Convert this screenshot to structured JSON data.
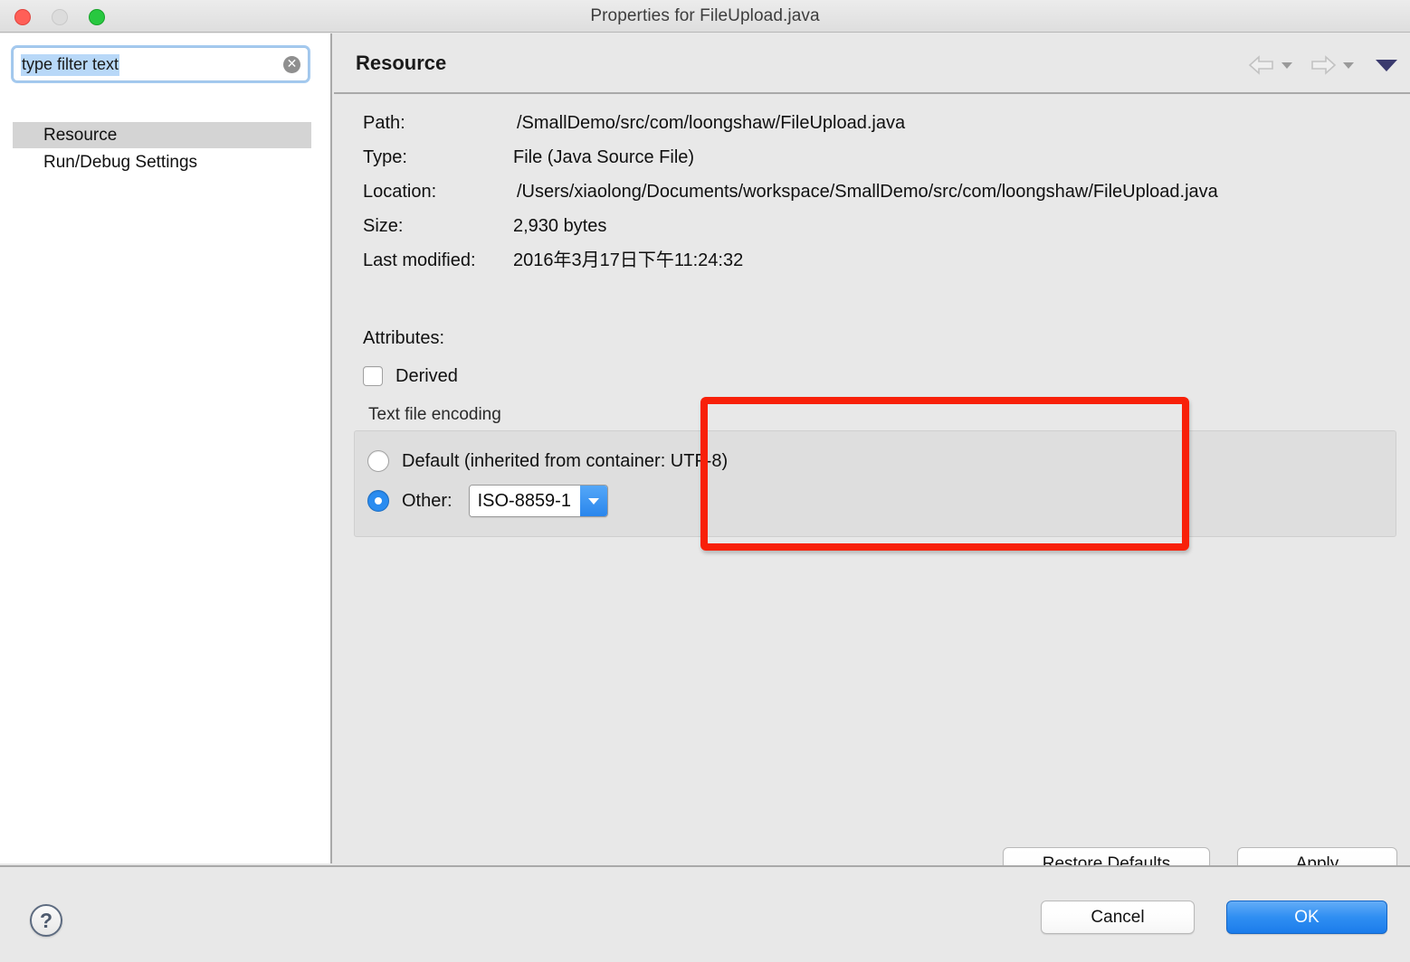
{
  "window": {
    "title": "Properties for FileUpload.java",
    "traffic_lights": {
      "close": "close-button",
      "minimize": "minimize-button",
      "zoom": "zoom-button"
    }
  },
  "sidebar": {
    "filter": {
      "value": "type filter text",
      "placeholder": "type filter text",
      "clear_icon": "clear-icon",
      "clear_glyph": "✕"
    },
    "items": [
      {
        "label": "Resource",
        "selected": true
      },
      {
        "label": "Run/Debug Settings",
        "selected": false
      }
    ]
  },
  "content": {
    "page_title": "Resource",
    "nav": {
      "back_icon": "arrow-left-icon",
      "forward_icon": "arrow-right-icon",
      "menu_icon": "chevron-down-icon"
    },
    "properties": [
      {
        "label": "Path:",
        "value": "/SmallDemo/src/com/loongshaw/FileUpload.java"
      },
      {
        "label": "Type:",
        "value": "File  (Java Source File)"
      },
      {
        "label": "Location:",
        "value": "/Users/xiaolong/Documents/workspace/SmallDemo/src/com/loongshaw/FileUpload.java"
      },
      {
        "label": "Size:",
        "value": "2,930  bytes"
      },
      {
        "label": "Last modified:",
        "value": "2016年3月17日下午11:24:32"
      }
    ],
    "attributes_label": "Attributes:",
    "derived": {
      "label": "Derived",
      "checked": false
    },
    "encoding_group": {
      "label": "Text file encoding",
      "options": [
        {
          "label": "Default (inherited from container: UTF-8)",
          "selected": false
        },
        {
          "label": "Other:",
          "selected": true
        }
      ],
      "combo": {
        "value": "ISO-8859-1",
        "arrow_icon": "chevron-down-icon"
      }
    },
    "restore_defaults_label": "Restore Defaults",
    "apply_label": "Apply"
  },
  "bottom": {
    "help_label": "?",
    "cancel_label": "Cancel",
    "ok_label": "OK"
  },
  "colors": {
    "accent_blue": "#2f8ef2",
    "annotation_red": "#f82009",
    "selection_blue": "#b8d8f8",
    "tree_selection_gray": "#d4d4d4",
    "panel_gray": "#e8e8e8"
  }
}
